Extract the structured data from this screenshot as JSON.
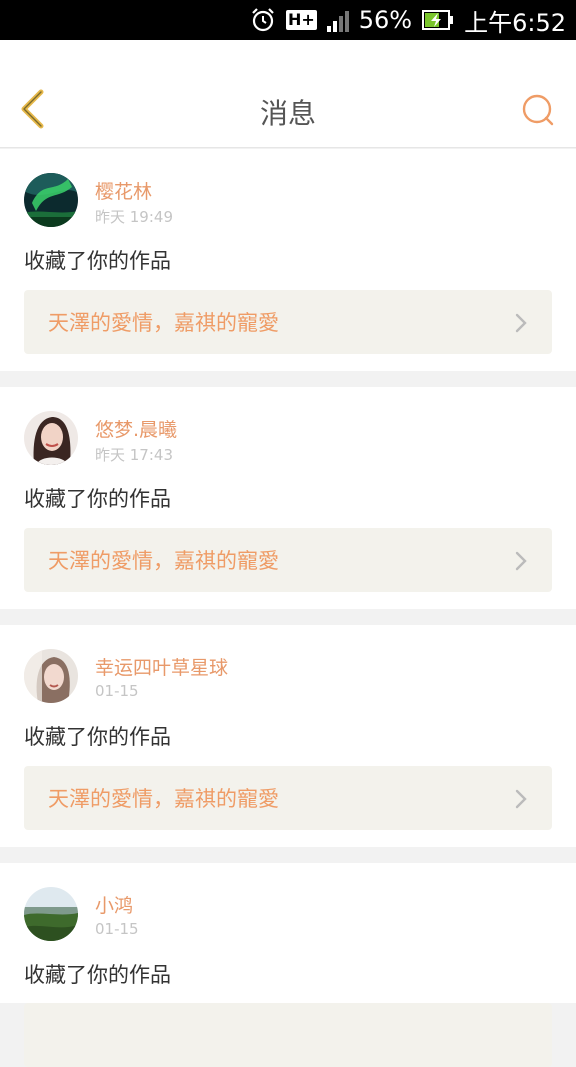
{
  "statusbar": {
    "network_type": "H+",
    "battery_percent": "56%",
    "time": "上午6:52",
    "icons": [
      "alarm-icon",
      "signal-icon",
      "battery-charging-icon"
    ]
  },
  "header": {
    "title": "消息",
    "back_icon": "chevron-left-icon",
    "search_icon": "search-icon",
    "accent_color": "#ef9c66"
  },
  "messages": [
    {
      "username": "樱花林",
      "timestamp": "昨天 19:49",
      "action": "收藏了你的作品",
      "work_title": "天澤的愛情，嘉祺的寵愛"
    },
    {
      "username": "悠梦.晨曦",
      "timestamp": "昨天 17:43",
      "action": "收藏了你的作品",
      "work_title": "天澤的愛情，嘉祺的寵愛"
    },
    {
      "username": "幸运四叶草星球",
      "timestamp": "01-15",
      "action": "收藏了你的作品",
      "work_title": "天澤的愛情，嘉祺的寵愛"
    },
    {
      "username": "小鸿",
      "timestamp": "01-15",
      "action": "收藏了你的作品",
      "work_title": ""
    }
  ]
}
